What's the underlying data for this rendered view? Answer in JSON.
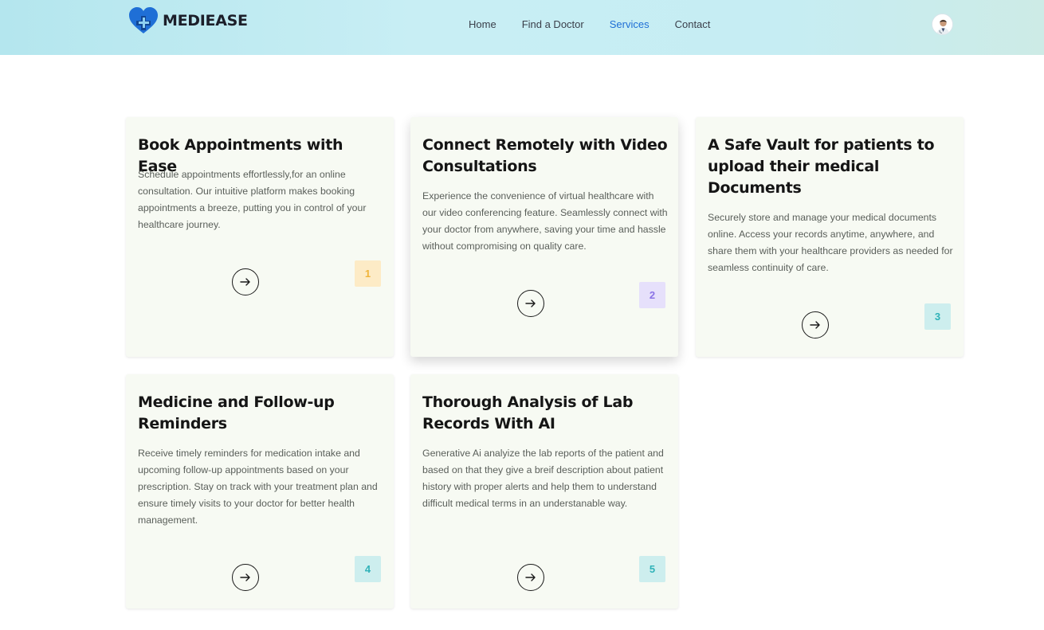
{
  "header": {
    "brand": "MEDIEASE",
    "nav": [
      {
        "label": "Home",
        "active": false
      },
      {
        "label": "Find a Doctor",
        "active": false
      },
      {
        "label": "Services",
        "active": true
      },
      {
        "label": "Contact",
        "active": false
      }
    ],
    "colors": {
      "nav_active": "#1f6fd6",
      "logo": "#1f6fd6"
    }
  },
  "cards": [
    {
      "title": "Book Appointments with Ease",
      "description": "Schedule appointments effortlessly,for an online consultation. Our intuitive platform makes booking appointments a breeze, putting you in control of your healthcare journey.",
      "number": "1",
      "badge_bg": "#fdebc6",
      "badge_color": "#f0b43a"
    },
    {
      "title": "Connect Remotely with Video Consultations",
      "description": "Experience the convenience of virtual healthcare with our video conferencing feature. Seamlessly connect with your doctor from anywhere, saving your time and hassle without compromising on quality care.",
      "number": "2",
      "badge_bg": "#e6e0fb",
      "badge_color": "#8b73e6"
    },
    {
      "title": "A Safe Vault for patients to upload their medical Documents",
      "description": "Securely store and manage your medical documents online. Access your records anytime, anywhere, and share them with your healthcare providers as needed for seamless continuity of care.",
      "number": "3",
      "badge_bg": "#cdeeee",
      "badge_color": "#2fb2b8"
    },
    {
      "title": "Medicine and Follow-up Reminders",
      "description": "Receive timely reminders for medication intake and upcoming follow-up appointments based on your prescription. Stay on track with your treatment plan and ensure timely visits to your doctor for better health management.",
      "number": "4",
      "badge_bg": "#cdeeee",
      "badge_color": "#2fb2b8"
    },
    {
      "title": "Thorough Analysis of Lab Records With AI",
      "description": "Generative Ai analyize the lab reports of the patient and based on that they give a breif description about patient history with proper alerts and help them to understand difficult medical terms in an understanable way.",
      "number": "5",
      "badge_bg": "#cdeeee",
      "badge_color": "#2fb2b8"
    }
  ]
}
